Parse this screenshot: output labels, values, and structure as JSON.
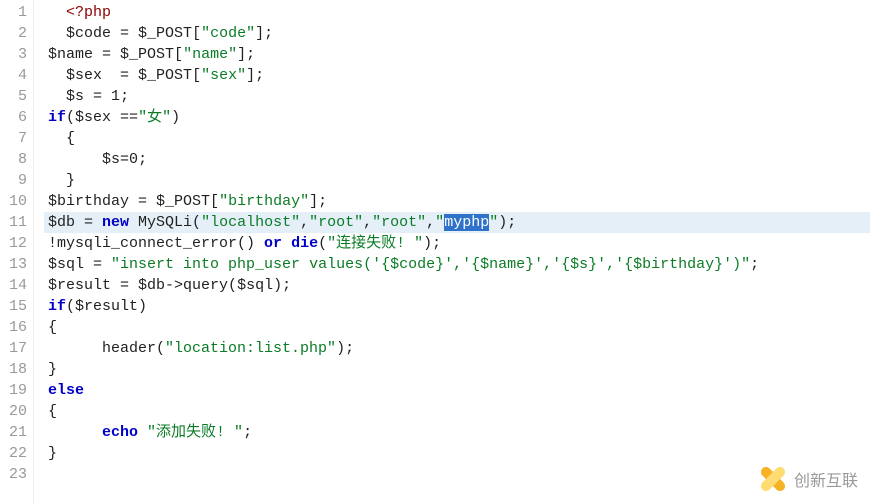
{
  "editor": {
    "active_line": 11,
    "line_count": 23,
    "selection": {
      "line": 11,
      "text": "myphp"
    },
    "lines": [
      {
        "n": 1,
        "indent": 1,
        "tokens": [
          {
            "t": "<?php",
            "cls": "c-tag"
          }
        ]
      },
      {
        "n": 2,
        "indent": 1,
        "tokens": [
          {
            "t": "$code",
            "cls": "c-var"
          },
          {
            "t": " = ",
            "cls": "c-op"
          },
          {
            "t": "$_POST",
            "cls": "c-var"
          },
          {
            "t": "[",
            "cls": "c-punct"
          },
          {
            "t": "\"code\"",
            "cls": "c-string"
          },
          {
            "t": "];",
            "cls": "c-punct"
          }
        ]
      },
      {
        "n": 3,
        "indent": 0,
        "tokens": [
          {
            "t": "$name",
            "cls": "c-var"
          },
          {
            "t": " = ",
            "cls": "c-op"
          },
          {
            "t": "$_POST",
            "cls": "c-var"
          },
          {
            "t": "[",
            "cls": "c-punct"
          },
          {
            "t": "\"name\"",
            "cls": "c-string"
          },
          {
            "t": "];",
            "cls": "c-punct"
          }
        ]
      },
      {
        "n": 4,
        "indent": 1,
        "tokens": [
          {
            "t": "$sex",
            "cls": "c-var"
          },
          {
            "t": "  = ",
            "cls": "c-op"
          },
          {
            "t": "$_POST",
            "cls": "c-var"
          },
          {
            "t": "[",
            "cls": "c-punct"
          },
          {
            "t": "\"sex\"",
            "cls": "c-string"
          },
          {
            "t": "];",
            "cls": "c-punct"
          }
        ]
      },
      {
        "n": 5,
        "indent": 1,
        "tokens": [
          {
            "t": "$s",
            "cls": "c-var"
          },
          {
            "t": " = ",
            "cls": "c-op"
          },
          {
            "t": "1",
            "cls": "c-default"
          },
          {
            "t": ";",
            "cls": "c-punct"
          }
        ]
      },
      {
        "n": 6,
        "indent": 0,
        "tokens": [
          {
            "t": "if",
            "cls": "c-keyword"
          },
          {
            "t": "(",
            "cls": "c-punct"
          },
          {
            "t": "$sex",
            "cls": "c-var"
          },
          {
            "t": " ==",
            "cls": "c-op"
          },
          {
            "t": "\"女\"",
            "cls": "c-string"
          },
          {
            "t": ")",
            "cls": "c-punct"
          }
        ]
      },
      {
        "n": 7,
        "indent": 1,
        "tokens": [
          {
            "t": "{",
            "cls": "c-punct"
          }
        ]
      },
      {
        "n": 8,
        "indent": 3,
        "tokens": [
          {
            "t": "$s",
            "cls": "c-var"
          },
          {
            "t": "=",
            "cls": "c-op"
          },
          {
            "t": "0",
            "cls": "c-default"
          },
          {
            "t": ";",
            "cls": "c-punct"
          }
        ]
      },
      {
        "n": 9,
        "indent": 1,
        "tokens": [
          {
            "t": "}",
            "cls": "c-punct"
          }
        ]
      },
      {
        "n": 10,
        "indent": 0,
        "tokens": [
          {
            "t": "$birthday",
            "cls": "c-var"
          },
          {
            "t": " = ",
            "cls": "c-op"
          },
          {
            "t": "$_POST",
            "cls": "c-var"
          },
          {
            "t": "[",
            "cls": "c-punct"
          },
          {
            "t": "\"birthday\"",
            "cls": "c-string"
          },
          {
            "t": "];",
            "cls": "c-punct"
          }
        ]
      },
      {
        "n": 11,
        "indent": 0,
        "tokens": [
          {
            "t": "$db",
            "cls": "c-var"
          },
          {
            "t": " = ",
            "cls": "c-op"
          },
          {
            "t": "new",
            "cls": "c-keyword"
          },
          {
            "t": " MySQLi(",
            "cls": "c-func"
          },
          {
            "t": "\"localhost\"",
            "cls": "c-string"
          },
          {
            "t": ",",
            "cls": "c-punct"
          },
          {
            "t": "\"root\"",
            "cls": "c-string"
          },
          {
            "t": ",",
            "cls": "c-punct"
          },
          {
            "t": "\"root\"",
            "cls": "c-string"
          },
          {
            "t": ",",
            "cls": "c-punct"
          },
          {
            "t": "\"",
            "cls": "c-string"
          },
          {
            "t": "myphp",
            "cls": "selected"
          },
          {
            "t": "\"",
            "cls": "c-string"
          },
          {
            "t": ");",
            "cls": "c-punct"
          }
        ]
      },
      {
        "n": 12,
        "indent": 0,
        "tokens": [
          {
            "t": "!mysqli_connect_error() ",
            "cls": "c-func"
          },
          {
            "t": "or",
            "cls": "c-keyword"
          },
          {
            "t": " ",
            "cls": "c-default"
          },
          {
            "t": "die",
            "cls": "c-keyword"
          },
          {
            "t": "(",
            "cls": "c-punct"
          },
          {
            "t": "\"连接失败! \"",
            "cls": "c-string"
          },
          {
            "t": ");",
            "cls": "c-punct"
          }
        ]
      },
      {
        "n": 13,
        "indent": 0,
        "tokens": [
          {
            "t": "$sql",
            "cls": "c-var"
          },
          {
            "t": " = ",
            "cls": "c-op"
          },
          {
            "t": "\"insert into php_user values('{$code}','{$name}','{$s}','{$birthday}')\"",
            "cls": "c-string"
          },
          {
            "t": ";",
            "cls": "c-punct"
          }
        ]
      },
      {
        "n": 14,
        "indent": 0,
        "tokens": [
          {
            "t": "$result",
            "cls": "c-var"
          },
          {
            "t": " = ",
            "cls": "c-op"
          },
          {
            "t": "$db",
            "cls": "c-var"
          },
          {
            "t": "->query(",
            "cls": "c-func"
          },
          {
            "t": "$sql",
            "cls": "c-var"
          },
          {
            "t": ");",
            "cls": "c-punct"
          }
        ]
      },
      {
        "n": 15,
        "indent": 0,
        "tokens": [
          {
            "t": "if",
            "cls": "c-keyword"
          },
          {
            "t": "(",
            "cls": "c-punct"
          },
          {
            "t": "$result",
            "cls": "c-var"
          },
          {
            "t": ")",
            "cls": "c-punct"
          }
        ]
      },
      {
        "n": 16,
        "indent": 0,
        "tokens": [
          {
            "t": "{",
            "cls": "c-punct"
          }
        ]
      },
      {
        "n": 17,
        "indent": 3,
        "tokens": [
          {
            "t": "header(",
            "cls": "c-func"
          },
          {
            "t": "\"location:list.php\"",
            "cls": "c-string"
          },
          {
            "t": ");",
            "cls": "c-punct"
          }
        ]
      },
      {
        "n": 18,
        "indent": 0,
        "tokens": [
          {
            "t": "}",
            "cls": "c-punct"
          }
        ]
      },
      {
        "n": 19,
        "indent": 0,
        "tokens": [
          {
            "t": "else",
            "cls": "c-keyword"
          }
        ]
      },
      {
        "n": 20,
        "indent": 0,
        "tokens": [
          {
            "t": "{",
            "cls": "c-punct"
          }
        ]
      },
      {
        "n": 21,
        "indent": 3,
        "tokens": [
          {
            "t": "echo",
            "cls": "c-keyword"
          },
          {
            "t": " ",
            "cls": "c-default"
          },
          {
            "t": "\"添加失败! \"",
            "cls": "c-string"
          },
          {
            "t": ";",
            "cls": "c-punct"
          }
        ]
      },
      {
        "n": 22,
        "indent": 0,
        "tokens": [
          {
            "t": "}",
            "cls": "c-punct"
          }
        ]
      },
      {
        "n": 23,
        "indent": 0,
        "tokens": []
      }
    ]
  },
  "watermark": {
    "text": "创新互联"
  }
}
